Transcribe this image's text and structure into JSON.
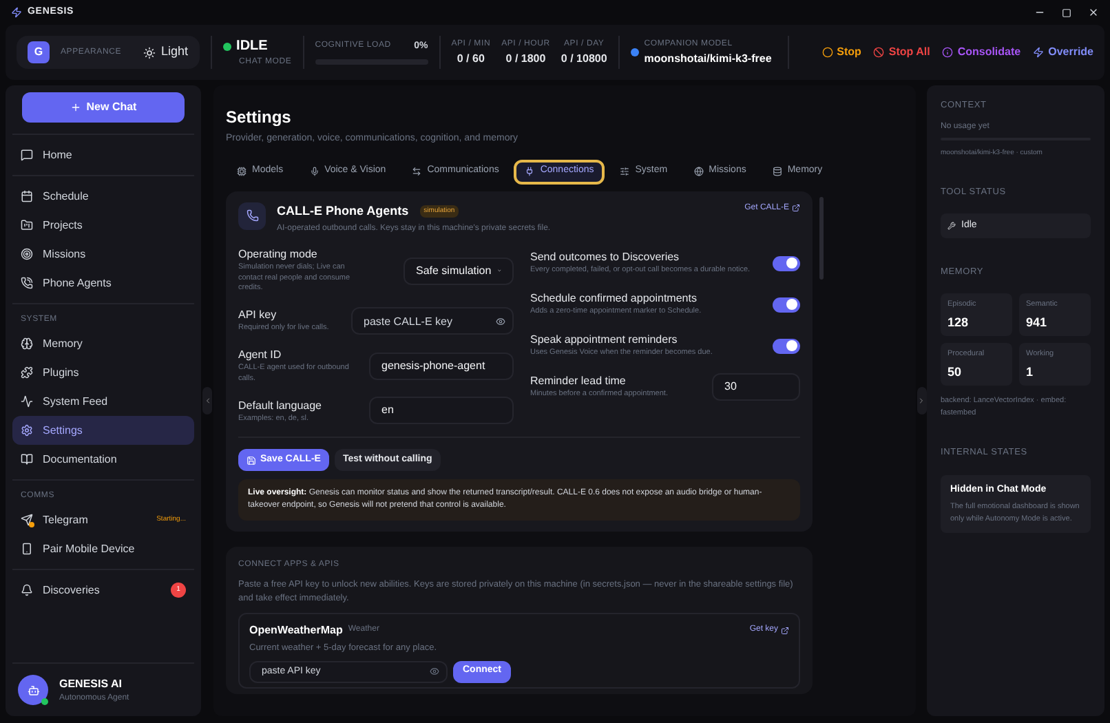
{
  "app_title": "GENESIS",
  "header": {
    "appearance": {
      "avatar": "G",
      "label": "APPEARANCE",
      "toggle": "Light"
    },
    "status": {
      "state": "IDLE",
      "mode": "CHAT MODE",
      "online": true
    },
    "cognitive_load": {
      "label": "COGNITIVE LOAD",
      "reading": "0%",
      "level": 0
    },
    "api_stats": [
      {
        "label": "API / MIN",
        "value": "0 / 60"
      },
      {
        "label": "API / HOUR",
        "value": "0 / 1800"
      },
      {
        "label": "API / DAY",
        "value": "0 / 10800"
      }
    ],
    "companion_model": {
      "label": "COMPANION MODEL",
      "value": "moonshotai/kimi-k3-free",
      "color": "#3b82f6"
    },
    "actions": [
      {
        "kind": "stop",
        "label": "Stop",
        "color": "#f59e0b"
      },
      {
        "kind": "stop_all",
        "label": "Stop All",
        "color": "#ef4444"
      },
      {
        "kind": "consolidate",
        "label": "Consolidate",
        "color": "#a855f7"
      },
      {
        "kind": "override",
        "label": "Override",
        "color": "#818cf8"
      }
    ]
  },
  "sidebar": {
    "new_chat": "New Chat",
    "sections": [
      {
        "items": [
          {
            "label": "Home",
            "selected": false
          }
        ]
      },
      {
        "items": [
          {
            "label": "Schedule",
            "selected": false
          },
          {
            "label": "Projects",
            "selected": false
          },
          {
            "label": "Missions",
            "selected": false
          },
          {
            "label": "Phone Agents",
            "selected": false
          }
        ]
      },
      {
        "label": "SYSTEM",
        "items": [
          {
            "label": "Memory",
            "selected": false
          },
          {
            "label": "Plugins",
            "selected": false
          },
          {
            "label": "System Feed",
            "selected": false
          },
          {
            "label": "Settings",
            "selected": true
          },
          {
            "label": "Documentation",
            "selected": false
          }
        ]
      },
      {
        "label": "COMMS",
        "items": [
          {
            "label": "Telegram",
            "selected": false,
            "status": "Starting..."
          },
          {
            "label": "Pair Mobile Device",
            "selected": false
          }
        ]
      },
      {
        "items": [
          {
            "label": "Discoveries",
            "selected": false,
            "badge": "1"
          }
        ]
      }
    ],
    "profile": {
      "name": "GENESIS AI",
      "role": "Autonomous Agent",
      "online": true
    }
  },
  "settings": {
    "title": "Settings",
    "subtitle": "Provider, generation, voice, communications, cognition, and memory",
    "tabs": [
      {
        "label": "Models",
        "selected": false
      },
      {
        "label": "Voice & Vision",
        "selected": false
      },
      {
        "label": "Communications",
        "selected": false
      },
      {
        "label": "Connections",
        "selected": true
      },
      {
        "label": "System",
        "selected": false
      },
      {
        "label": "Missions",
        "selected": false
      },
      {
        "label": "Memory",
        "selected": false
      }
    ],
    "phone_card": {
      "title": "CALL-E Phone Agents",
      "badge": "simulation",
      "description": "AI-operated outbound calls. Keys stay in this machine's private secrets file.",
      "link": "Get CALL-E",
      "fields": [
        {
          "kind": "select",
          "label": "Operating mode",
          "hint": "Simulation never dials; Live can contact real people and consume credits.",
          "value": "Safe simulation"
        },
        {
          "kind": "secret",
          "label": "API key",
          "hint": "Required only for live calls.",
          "placeholder": "paste CALL-E key"
        },
        {
          "kind": "text",
          "label": "Agent ID",
          "hint": "CALL-E agent used for outbound calls.",
          "value": "genesis-phone-agent"
        },
        {
          "kind": "text",
          "label": "Default language",
          "hint": "Examples: en, de, sl.",
          "value": "en"
        }
      ],
      "options": [
        {
          "kind": "toggle",
          "label": "Send outcomes to Discoveries",
          "hint": "Every completed, failed, or opt-out call becomes a durable notice.",
          "on": true
        },
        {
          "kind": "toggle",
          "label": "Schedule confirmed appointments",
          "hint": "Adds a zero-time appointment marker to Schedule.",
          "on": true
        },
        {
          "kind": "toggle",
          "label": "Speak appointment reminders",
          "hint": "Uses Genesis Voice when the reminder becomes due.",
          "on": true
        },
        {
          "kind": "number",
          "label": "Reminder lead time",
          "hint": "Minutes before a confirmed appointment.",
          "value": "30"
        }
      ],
      "buttons": [
        {
          "kind": "primary",
          "label": "Save CALL-E"
        },
        {
          "kind": "secondary",
          "label": "Test without calling"
        }
      ],
      "notice": "**Live oversight:** Genesis can monitor status and show the returned transcript/result. CALL-E 0.6 does not expose an audio bridge or human-takeover endpoint, so Genesis will not pretend that control is available."
    },
    "connect": {
      "heading": "CONNECT APPS & APIS",
      "description": "Paste a free API key to unlock new abilities. Keys are stored privately on this machine (in secrets.json — never in the shareable settings file) and take effect immediately.",
      "services": [
        {
          "name": "OpenWeatherMap",
          "tag": "Weather",
          "description": "Current weather + 5-day forecast for any place.",
          "link": "Get key",
          "placeholder": "paste API key",
          "button": "Connect"
        }
      ]
    }
  },
  "right_panel": {
    "context": {
      "heading": "CONTEXT",
      "usage": "No usage yet",
      "level": 0,
      "model": "moonshotai/kimi-k3-free · custom"
    },
    "tool_status": {
      "heading": "TOOL STATUS",
      "value": "Idle"
    },
    "memory": {
      "heading": "MEMORY",
      "stats": [
        {
          "label": "Episodic",
          "value": "128"
        },
        {
          "label": "Semantic",
          "value": "941"
        },
        {
          "label": "Procedural",
          "value": "50"
        },
        {
          "label": "Working",
          "value": "1"
        }
      ],
      "backend": "backend: LanceVectorIndex · embed: fastembed"
    },
    "internal_states": {
      "heading": "INTERNAL STATES",
      "title": "Hidden in Chat Mode",
      "text": "The full emotional dashboard is shown only while Autonomy Mode is active."
    }
  }
}
